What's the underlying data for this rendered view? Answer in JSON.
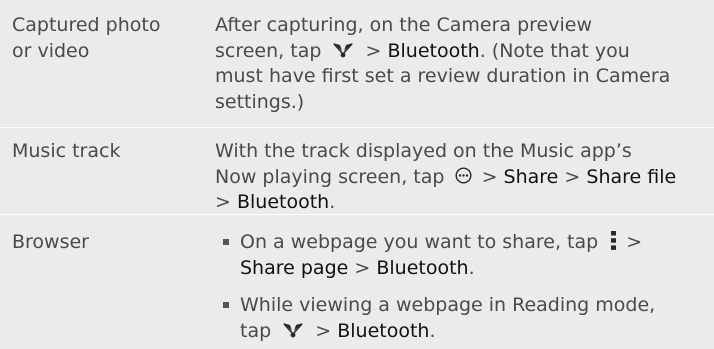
{
  "rows": [
    {
      "label_lines": [
        "Captured photo",
        "or video"
      ],
      "desc": {
        "l1": "After capturing, on the Camera preview",
        "l2_pre": "screen, tap",
        "l2_gt": ">",
        "l2_ui": "Bluetooth",
        "l2_post": ". (Note that you",
        "l3": "must have first set a review duration in Camera",
        "l4": "settings.)"
      }
    },
    {
      "label": "Music track",
      "desc": {
        "l1": "With the track displayed on the Music app’s",
        "l2_pre": "Now playing screen, tap",
        "l2_gt1": ">",
        "l2_ui1": "Share",
        "l2_gt2": ">",
        "l2_ui2": "Share file",
        "l3_gt": ">",
        "l3_ui": "Bluetooth",
        "l3_post": "."
      }
    },
    {
      "label": "Browser",
      "bullets": [
        {
          "l1_pre": "On a webpage you want to share, tap",
          "l1_gt": ">",
          "l2_ui1": "Share page",
          "l2_gt": ">",
          "l2_ui2": "Bluetooth",
          "l2_post": "."
        },
        {
          "l1": "While viewing a webpage in Reading mode,",
          "l2_pre": "tap",
          "l2_gt": ">",
          "l2_ui": "Bluetooth",
          "l2_post": "."
        }
      ]
    }
  ],
  "icons": {
    "share": "share-icon",
    "more": "more-options-icon",
    "menu": "menu-icon"
  },
  "colors": {
    "background": "#ebebeb",
    "text": "#4a4a4a",
    "ui_text": "#111111",
    "divider": "#ffffff"
  }
}
